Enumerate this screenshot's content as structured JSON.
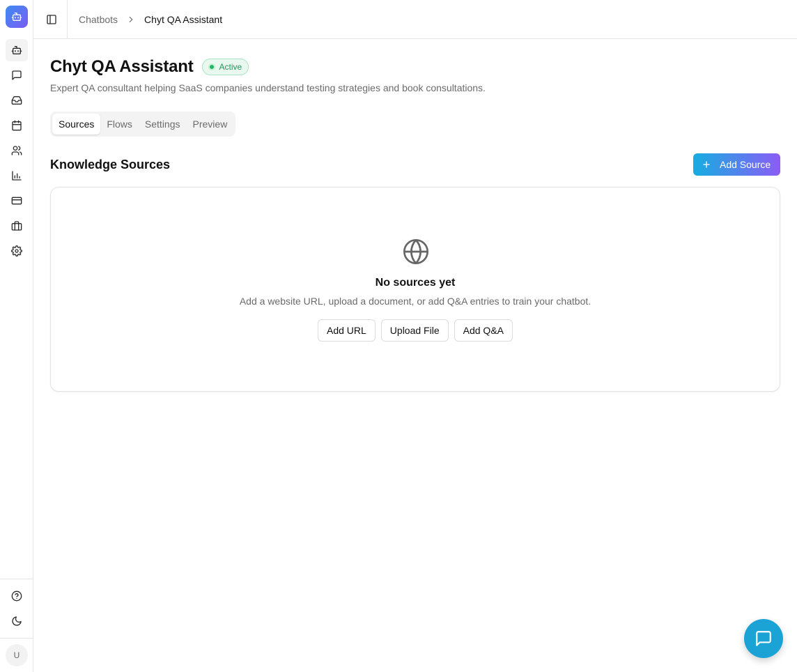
{
  "sidebar": {
    "logo_icon": "bot-icon",
    "items": [
      {
        "id": "chatbots",
        "icon": "bot-icon"
      },
      {
        "id": "conversations",
        "icon": "message-square-icon"
      },
      {
        "id": "inbox",
        "icon": "inbox-icon"
      },
      {
        "id": "calendar",
        "icon": "calendar-icon"
      },
      {
        "id": "contacts",
        "icon": "users-icon"
      },
      {
        "id": "analytics",
        "icon": "bar-chart-icon"
      },
      {
        "id": "billing",
        "icon": "credit-card-icon"
      },
      {
        "id": "integrations",
        "icon": "briefcase-icon"
      },
      {
        "id": "settings",
        "icon": "gear-icon"
      }
    ],
    "bottom_items": [
      {
        "id": "help",
        "icon": "help-circle-icon"
      },
      {
        "id": "theme",
        "icon": "moon-icon"
      }
    ],
    "avatar_initial": "U"
  },
  "header": {
    "breadcrumb": {
      "parent": "Chatbots",
      "current": "Chyt QA Assistant"
    }
  },
  "page": {
    "title": "Chyt QA Assistant",
    "status": "Active",
    "description": "Expert QA consultant helping SaaS companies understand testing strategies and book consultations."
  },
  "tabs": [
    {
      "label": "Sources",
      "active": true
    },
    {
      "label": "Flows",
      "active": false
    },
    {
      "label": "Settings",
      "active": false
    },
    {
      "label": "Preview",
      "active": false
    }
  ],
  "sources": {
    "section_title": "Knowledge Sources",
    "add_button": "Add Source",
    "empty": {
      "icon": "globe-icon",
      "title": "No sources yet",
      "description": "Add a website URL, upload a document, or add Q&A entries to train your chatbot.",
      "actions": [
        "Add URL",
        "Upload File",
        "Add Q&A"
      ]
    }
  },
  "colors": {
    "accent_gradient_start": "#15aee0",
    "accent_gradient_end": "#8b5cf6",
    "status_green": "#22b85f",
    "fab": "#1ba3d6"
  }
}
